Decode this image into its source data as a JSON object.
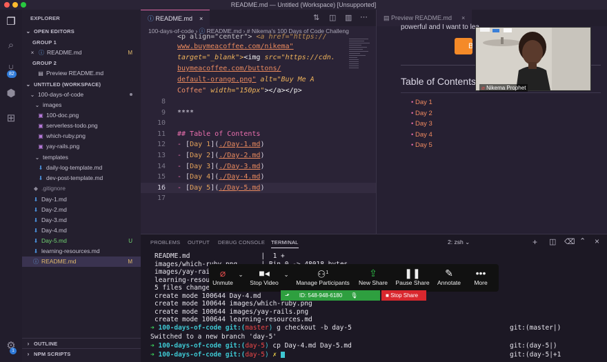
{
  "window": {
    "title": "README.md — Untitled (Workspace) [Unsupported]"
  },
  "activity_bar": {
    "extensions_badge": "82",
    "accounts_badge": "1"
  },
  "sidebar": {
    "title": "EXPLORER",
    "open_editors": "OPEN EDITORS",
    "group1": "GROUP 1",
    "group1_item": "README.md",
    "group1_item_status": "M",
    "group2": "GROUP 2",
    "group2_item": "Preview README.md",
    "workspace": "UNTITLED (WORKSPACE)",
    "root_folder": "100-days-of-code",
    "images_folder": "images",
    "images": [
      "100-doc.png",
      "serverless-todo.png",
      "which-ruby.png",
      "yay-rails.png"
    ],
    "templates_folder": "templates",
    "templates": [
      "daily-log-template.md",
      "dev-post-template.md"
    ],
    "files": [
      {
        "name": ".gitignore",
        "status": ""
      },
      {
        "name": "Day-1.md",
        "status": ""
      },
      {
        "name": "Day-2.md",
        "status": ""
      },
      {
        "name": "Day-3.md",
        "status": ""
      },
      {
        "name": "Day-4.md",
        "status": ""
      },
      {
        "name": "Day-5.md",
        "status": "U"
      },
      {
        "name": "learning-resources.md",
        "status": ""
      },
      {
        "name": "README.md",
        "status": "M"
      }
    ],
    "outline": "OUTLINE",
    "npm_scripts": "NPM SCRIPTS"
  },
  "editor": {
    "tab_label": "README.md",
    "tab_status": "M",
    "breadcrumb": [
      "100-days-of-code",
      "README.md",
      "# Nikema's 100 Days of Code Challeng"
    ],
    "wrapped_top": {
      "l0_a": "<p align=\"center\">",
      "l0_b": "<a href=\"https://",
      "l1": "www.buymeacoffee.com/nikema\"",
      "l2_attr": "target=\"_blank\">",
      "l2_tag": "<img",
      "l2_src": "src=\"https://cdn.",
      "l3": "buymeacoffee.com/buttons/",
      "l4_a": "default-orange.png\"",
      "l4_b": "alt=\"Buy Me A",
      "l5_a": "Coffee\"",
      "l5_b": "width=\"150px\"",
      "l5_c": "></a></p>"
    },
    "lines": [
      {
        "n": "8",
        "text": ""
      },
      {
        "n": "9",
        "text": "****"
      },
      {
        "n": "10",
        "text": ""
      },
      {
        "n": "11",
        "text": "## Table of Contents"
      },
      {
        "n": "12",
        "text": "- [Day 1](./Day-1.md)",
        "label": "Day 1",
        "link": "./Day-1.md"
      },
      {
        "n": "13",
        "text": "- [Day 2](./Day-2.md)",
        "label": "Day 2",
        "link": "./Day-2.md"
      },
      {
        "n": "14",
        "text": "- [Day 3](./Day-3.md)",
        "label": "Day 3",
        "link": "./Day-3.md"
      },
      {
        "n": "15",
        "text": "- [Day 4](./Day-4.md)",
        "label": "Day 4",
        "link": "./Day-4.md"
      },
      {
        "n": "16",
        "text": "- [Day 5](./Day-5.md)",
        "label": "Day 5",
        "link": "./Day-5.md"
      },
      {
        "n": "17",
        "text": ""
      }
    ]
  },
  "preview": {
    "tab_label": "Preview README.md",
    "top_text": "powerful and I want to lea",
    "button_glyph": "B",
    "heading": "Table of Contents",
    "items": [
      "Day 1",
      "Day 2",
      "Day 3",
      "Day 4",
      "Day 5"
    ]
  },
  "panel": {
    "tabs": [
      "PROBLEMS",
      "OUTPUT",
      "DEBUG CONSOLE",
      "TERMINAL"
    ],
    "shell_select": "2: zsh",
    "terminal_lines": [
      "README.md                  |  1 +",
      "images/which-ruby.png      | Bin 0 -> 48018 bytes",
      "images/yay-rai",
      "learning-resou",
      "5 files changed, 7 insertions(+)",
      "create mode 100644 Day-4.md",
      "create mode 100644 images/which-ruby.png",
      "create mode 100644 images/yay-rails.png",
      "create mode 100644 learning-resources.md"
    ],
    "prompts": [
      {
        "arrow": "➜",
        "dir": "100-days-of-code",
        "git": "git:(",
        "branch": "master",
        "close": ")",
        "cmd": "g checkout -b day-5",
        "right": "git:(master|)"
      },
      {
        "plain": "Switched to a new branch 'day-5'"
      },
      {
        "arrow": "➜",
        "dir": "100-days-of-code",
        "git": "git:(",
        "branch": "day-5",
        "close": ")",
        "cmd": "cp Day-4.md Day-5.md",
        "right": "git:(day-5|)"
      },
      {
        "arrow": "➜",
        "dir": "100-days-of-code",
        "git": "git:(",
        "branch": "day-5",
        "close": ")",
        "cmd": "✗",
        "right": "git:(day-5|+1"
      }
    ]
  },
  "zoom": {
    "buttons": [
      "Unmute",
      "Stop Video",
      "Manage Participants",
      "New Share",
      "Pause Share",
      "Annotate",
      "More"
    ],
    "participants_count": "1",
    "meeting_id": "ID: 548-948-6180",
    "stop_share": "Stop Share",
    "camera_name": "Nikema Prophet"
  },
  "colors": {
    "accent": "#e06aa4",
    "stop": "#d9272e",
    "green": "#2e9f3f"
  }
}
